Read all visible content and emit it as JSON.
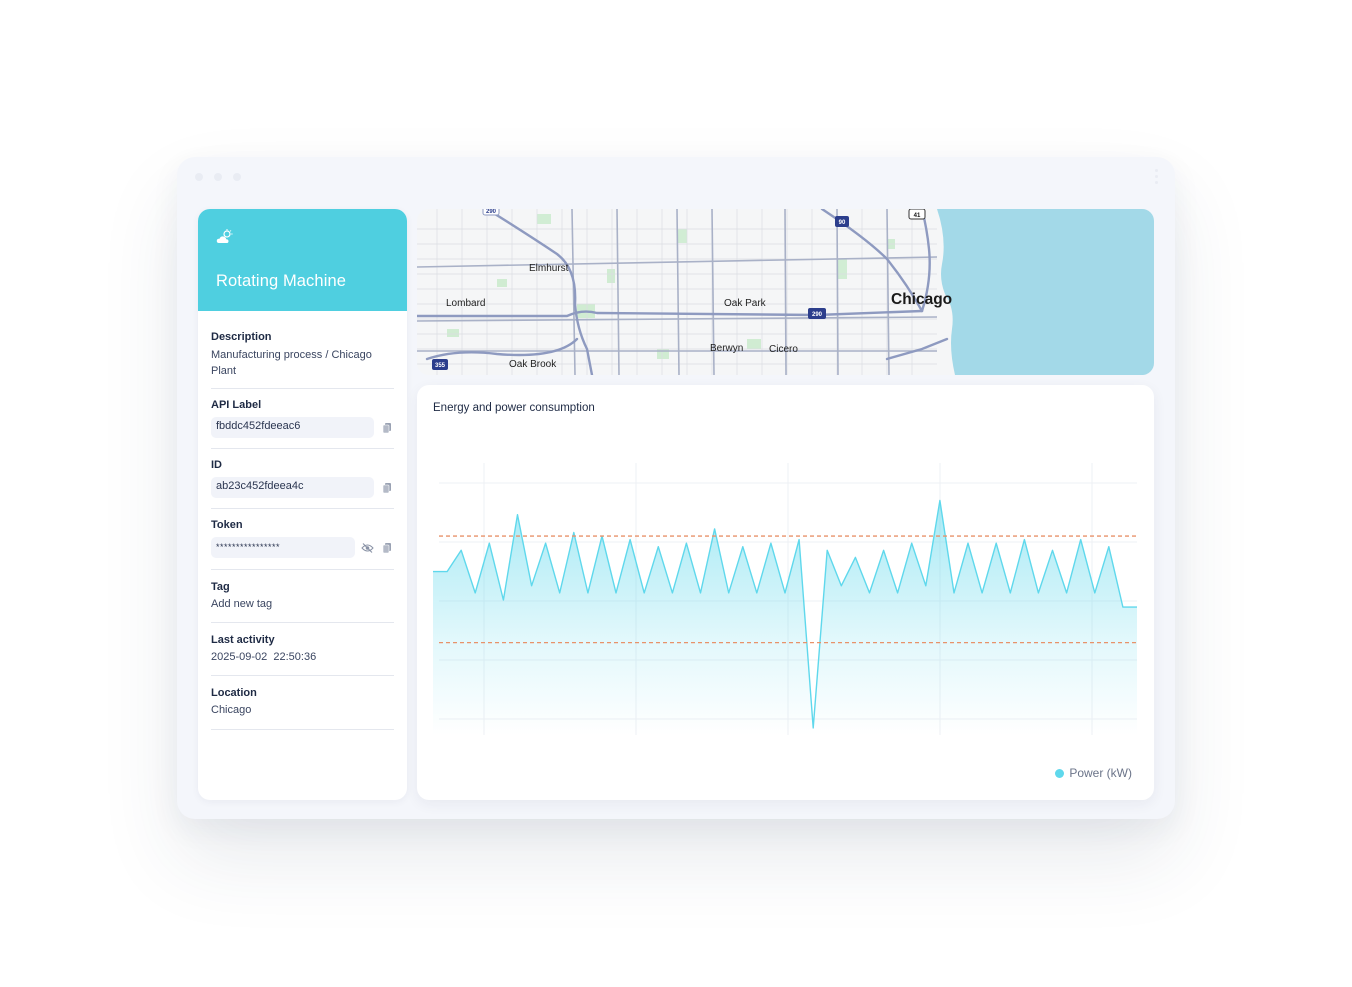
{
  "device": {
    "title": "Rotating Machine",
    "icon": "cloud-sun-icon",
    "accent_color": "#4fcfe0",
    "fields": {
      "description": {
        "label": "Description",
        "value": "Manufacturing process / Chicago Plant"
      },
      "api_label": {
        "label": "API Label",
        "value": "fbddc452fdeeac6"
      },
      "id": {
        "label": "ID",
        "value": "ab23c452fdeea4c"
      },
      "token": {
        "label": "Token",
        "value": "****************"
      },
      "tag": {
        "label": "Tag",
        "value": "Add new tag"
      },
      "last_activity": {
        "label": "Last activity",
        "value": "2025-09-02  22:50:36"
      },
      "location": {
        "label": "Location",
        "value": "Chicago"
      }
    }
  },
  "map": {
    "places": [
      "Elmhurst",
      "Lombard",
      "Oak Park",
      "Chicago",
      "Berwyn",
      "Cicero",
      "Oak Brook"
    ],
    "highway_shields": [
      "290",
      "90",
      "41",
      "290",
      "355"
    ],
    "water_color": "#a3d9e8"
  },
  "chart": {
    "title": "Energy and power consumption",
    "chart_data": {
      "type": "area",
      "title": "Energy and power consumption",
      "series": [
        {
          "name": "Power (kW)",
          "color": "#5fd8ec",
          "values": [
            0.5,
            0.5,
            0.8,
            0.2,
            0.9,
            0.1,
            1.3,
            0.3,
            0.9,
            0.2,
            1.05,
            0.2,
            1.0,
            0.2,
            0.95,
            0.2,
            0.85,
            0.2,
            0.9,
            0.2,
            1.1,
            0.2,
            0.85,
            0.2,
            0.9,
            0.2,
            0.95,
            -1.7,
            0.8,
            0.3,
            0.7,
            0.2,
            0.8,
            0.2,
            0.9,
            0.3,
            1.5,
            0.2,
            0.9,
            0.2,
            0.9,
            0.2,
            0.95,
            0.2,
            0.8,
            0.2,
            0.95,
            0.2,
            0.85,
            0.0,
            0.0
          ]
        }
      ],
      "thresholds": [
        1.0,
        -0.5
      ],
      "threshold_color": "#e8926a",
      "ylim": [
        -1.8,
        2.0
      ],
      "grid": true,
      "legend": "bottom-right"
    }
  }
}
